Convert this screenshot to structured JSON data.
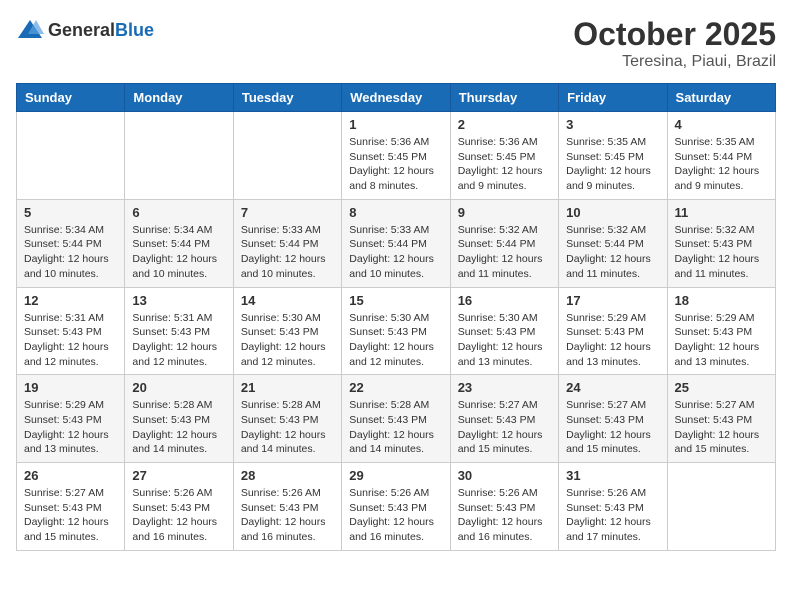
{
  "header": {
    "logo_general": "General",
    "logo_blue": "Blue",
    "month": "October 2025",
    "location": "Teresina, Piaui, Brazil"
  },
  "weekdays": [
    "Sunday",
    "Monday",
    "Tuesday",
    "Wednesday",
    "Thursday",
    "Friday",
    "Saturday"
  ],
  "weeks": [
    [
      {
        "day": "",
        "info": ""
      },
      {
        "day": "",
        "info": ""
      },
      {
        "day": "",
        "info": ""
      },
      {
        "day": "1",
        "info": "Sunrise: 5:36 AM\nSunset: 5:45 PM\nDaylight: 12 hours\nand 8 minutes."
      },
      {
        "day": "2",
        "info": "Sunrise: 5:36 AM\nSunset: 5:45 PM\nDaylight: 12 hours\nand 9 minutes."
      },
      {
        "day": "3",
        "info": "Sunrise: 5:35 AM\nSunset: 5:45 PM\nDaylight: 12 hours\nand 9 minutes."
      },
      {
        "day": "4",
        "info": "Sunrise: 5:35 AM\nSunset: 5:44 PM\nDaylight: 12 hours\nand 9 minutes."
      }
    ],
    [
      {
        "day": "5",
        "info": "Sunrise: 5:34 AM\nSunset: 5:44 PM\nDaylight: 12 hours\nand 10 minutes."
      },
      {
        "day": "6",
        "info": "Sunrise: 5:34 AM\nSunset: 5:44 PM\nDaylight: 12 hours\nand 10 minutes."
      },
      {
        "day": "7",
        "info": "Sunrise: 5:33 AM\nSunset: 5:44 PM\nDaylight: 12 hours\nand 10 minutes."
      },
      {
        "day": "8",
        "info": "Sunrise: 5:33 AM\nSunset: 5:44 PM\nDaylight: 12 hours\nand 10 minutes."
      },
      {
        "day": "9",
        "info": "Sunrise: 5:32 AM\nSunset: 5:44 PM\nDaylight: 12 hours\nand 11 minutes."
      },
      {
        "day": "10",
        "info": "Sunrise: 5:32 AM\nSunset: 5:44 PM\nDaylight: 12 hours\nand 11 minutes."
      },
      {
        "day": "11",
        "info": "Sunrise: 5:32 AM\nSunset: 5:43 PM\nDaylight: 12 hours\nand 11 minutes."
      }
    ],
    [
      {
        "day": "12",
        "info": "Sunrise: 5:31 AM\nSunset: 5:43 PM\nDaylight: 12 hours\nand 12 minutes."
      },
      {
        "day": "13",
        "info": "Sunrise: 5:31 AM\nSunset: 5:43 PM\nDaylight: 12 hours\nand 12 minutes."
      },
      {
        "day": "14",
        "info": "Sunrise: 5:30 AM\nSunset: 5:43 PM\nDaylight: 12 hours\nand 12 minutes."
      },
      {
        "day": "15",
        "info": "Sunrise: 5:30 AM\nSunset: 5:43 PM\nDaylight: 12 hours\nand 12 minutes."
      },
      {
        "day": "16",
        "info": "Sunrise: 5:30 AM\nSunset: 5:43 PM\nDaylight: 12 hours\nand 13 minutes."
      },
      {
        "day": "17",
        "info": "Sunrise: 5:29 AM\nSunset: 5:43 PM\nDaylight: 12 hours\nand 13 minutes."
      },
      {
        "day": "18",
        "info": "Sunrise: 5:29 AM\nSunset: 5:43 PM\nDaylight: 12 hours\nand 13 minutes."
      }
    ],
    [
      {
        "day": "19",
        "info": "Sunrise: 5:29 AM\nSunset: 5:43 PM\nDaylight: 12 hours\nand 13 minutes."
      },
      {
        "day": "20",
        "info": "Sunrise: 5:28 AM\nSunset: 5:43 PM\nDaylight: 12 hours\nand 14 minutes."
      },
      {
        "day": "21",
        "info": "Sunrise: 5:28 AM\nSunset: 5:43 PM\nDaylight: 12 hours\nand 14 minutes."
      },
      {
        "day": "22",
        "info": "Sunrise: 5:28 AM\nSunset: 5:43 PM\nDaylight: 12 hours\nand 14 minutes."
      },
      {
        "day": "23",
        "info": "Sunrise: 5:27 AM\nSunset: 5:43 PM\nDaylight: 12 hours\nand 15 minutes."
      },
      {
        "day": "24",
        "info": "Sunrise: 5:27 AM\nSunset: 5:43 PM\nDaylight: 12 hours\nand 15 minutes."
      },
      {
        "day": "25",
        "info": "Sunrise: 5:27 AM\nSunset: 5:43 PM\nDaylight: 12 hours\nand 15 minutes."
      }
    ],
    [
      {
        "day": "26",
        "info": "Sunrise: 5:27 AM\nSunset: 5:43 PM\nDaylight: 12 hours\nand 15 minutes."
      },
      {
        "day": "27",
        "info": "Sunrise: 5:26 AM\nSunset: 5:43 PM\nDaylight: 12 hours\nand 16 minutes."
      },
      {
        "day": "28",
        "info": "Sunrise: 5:26 AM\nSunset: 5:43 PM\nDaylight: 12 hours\nand 16 minutes."
      },
      {
        "day": "29",
        "info": "Sunrise: 5:26 AM\nSunset: 5:43 PM\nDaylight: 12 hours\nand 16 minutes."
      },
      {
        "day": "30",
        "info": "Sunrise: 5:26 AM\nSunset: 5:43 PM\nDaylight: 12 hours\nand 16 minutes."
      },
      {
        "day": "31",
        "info": "Sunrise: 5:26 AM\nSunset: 5:43 PM\nDaylight: 12 hours\nand 17 minutes."
      },
      {
        "day": "",
        "info": ""
      }
    ]
  ]
}
